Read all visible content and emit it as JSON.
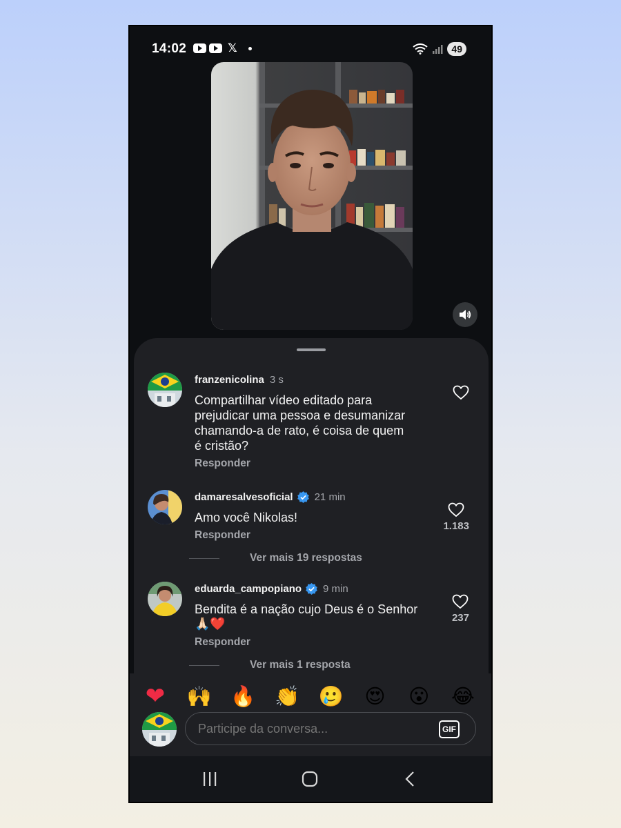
{
  "status_bar": {
    "time": "14:02",
    "notification_icons": [
      "youtube-icon",
      "youtube-icon",
      "x-icon",
      "dot-icon"
    ],
    "battery": "49"
  },
  "video": {
    "mute_icon": "speaker-icon"
  },
  "comments": [
    {
      "username": "franzenicolina",
      "verified": false,
      "time": "3 s",
      "text_lines": [
        "Compartilhar  vídeo  editado para",
        "prejudicar uma pessoa  e desumanizar",
        "chamando-a  de rato, é  coisa  de quem",
        "é  cristão?"
      ],
      "reply_label": "Responder",
      "likes": ""
    },
    {
      "username": "damaresalvesoficial",
      "verified": true,
      "time": "21 min",
      "text_lines": [
        "Amo você Nikolas!"
      ],
      "reply_label": "Responder",
      "likes": "1.183",
      "more_replies": "Ver mais 19 respostas"
    },
    {
      "username": "eduarda_campopiano",
      "verified": true,
      "time": "9 min",
      "text_lines": [
        "Bendita é a nação cujo Deus é o Senhor",
        "🙏🏻❤️"
      ],
      "reply_label": "Responder",
      "likes": "237",
      "more_replies": "Ver mais 1 resposta"
    }
  ],
  "quick_reactions": [
    "❤",
    "🙌",
    "🔥",
    "👏",
    "🥲",
    "😍",
    "😮",
    "😂"
  ],
  "composer": {
    "placeholder": "Participe da conversa...",
    "gif_label": "GIF"
  },
  "colors": {
    "sheet_bg": "#1f2024",
    "verified_blue": "#3897f0",
    "heart_red": "#ef2b45"
  }
}
